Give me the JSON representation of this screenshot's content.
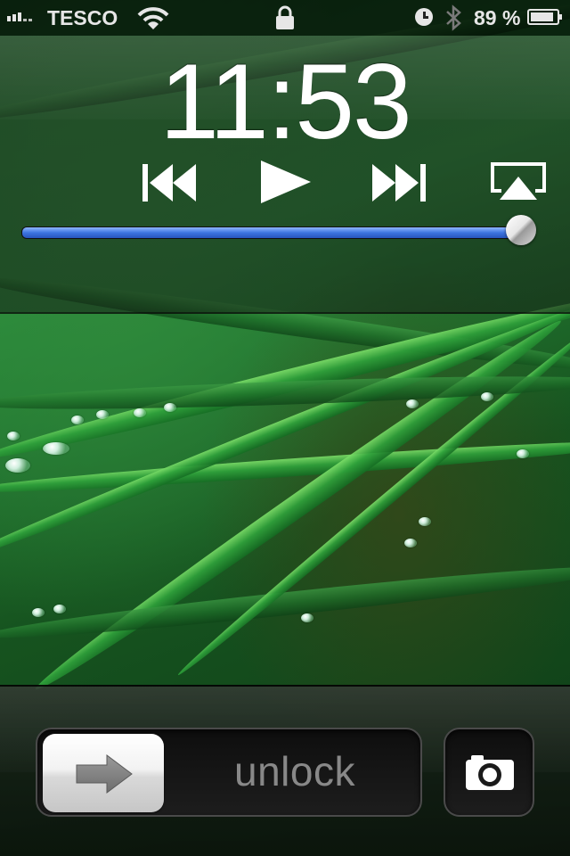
{
  "status_bar": {
    "carrier": "TESCO",
    "battery_percent": "89 %",
    "battery_level": 0.89,
    "icons": [
      "signal-bars-icon",
      "wifi-icon",
      "lock-icon",
      "alarm-clock-icon",
      "bluetooth-icon",
      "battery-icon"
    ]
  },
  "lock_screen": {
    "time": "11:53"
  },
  "media_controls": {
    "icons": [
      "previous-track-icon",
      "play-icon",
      "next-track-icon",
      "airplay-icon"
    ],
    "volume_level": 0.98,
    "accent_color": "#3d74e0"
  },
  "unlock": {
    "slider_label": "unlock",
    "knob_icon": "arrow-right-icon",
    "camera_icon": "camera-icon"
  }
}
